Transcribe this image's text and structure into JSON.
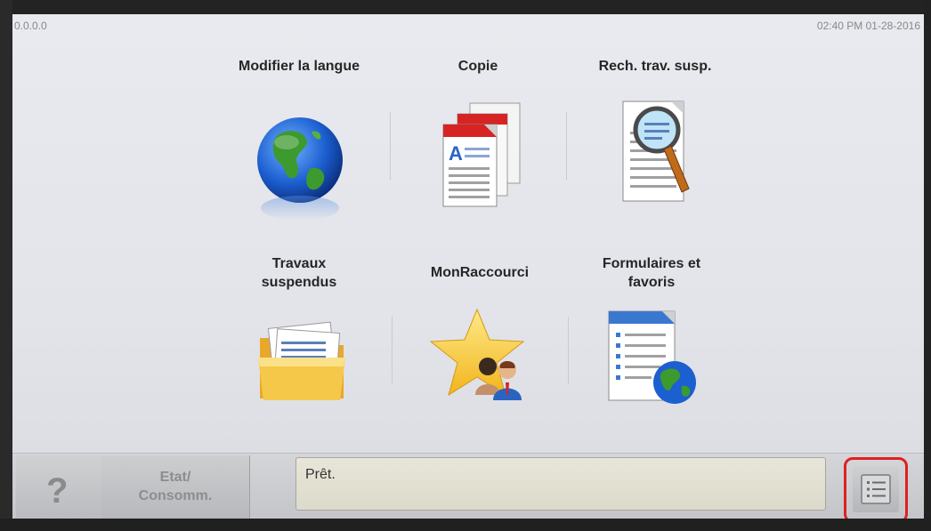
{
  "statusbar": {
    "left_text": "0.0.0.0",
    "datetime": "02:40 PM 01-28-2016"
  },
  "tiles": [
    {
      "label": "Modifier la langue",
      "icon": "globe-icon"
    },
    {
      "label": "Copie",
      "icon": "copy-documents-icon"
    },
    {
      "label": "Rech. trav. susp.",
      "icon": "search-document-magnifier-icon"
    },
    {
      "label": "Travaux\nsuspendus",
      "icon": "folder-documents-icon"
    },
    {
      "label": "MonRaccourci",
      "icon": "star-users-icon"
    },
    {
      "label": "Formulaires et\nfavoris",
      "icon": "document-globe-icon"
    }
  ],
  "bottombar": {
    "help_label": "?",
    "status_label": "Etat/\nConsomm.",
    "message": "Prêt.",
    "menu_icon": "menu-list-icon"
  },
  "colors": {
    "highlight": "#e02020",
    "screen_bg": "#e6e7ec"
  }
}
